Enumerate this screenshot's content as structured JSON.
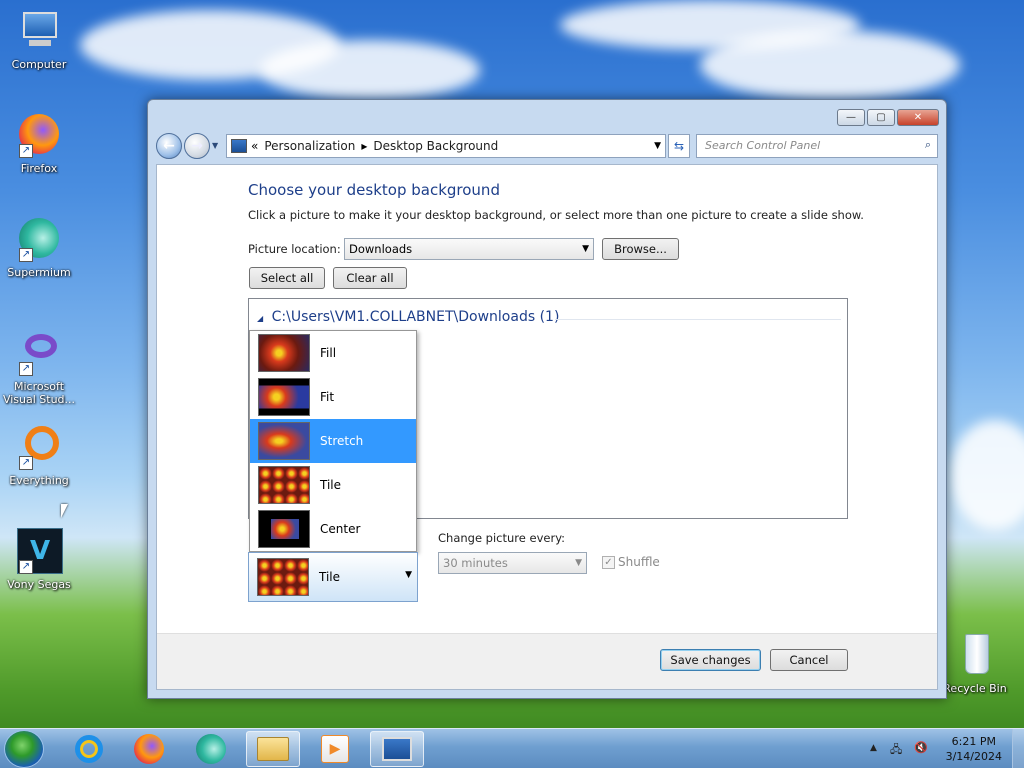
{
  "desktop": {
    "icons": [
      {
        "label": "Computer"
      },
      {
        "label": "Firefox"
      },
      {
        "label": "Supermium"
      },
      {
        "label": "Microsoft Visual Stud..."
      },
      {
        "label": "Everything"
      },
      {
        "label": "Vony Segas"
      },
      {
        "label": "Recycle Bin"
      }
    ]
  },
  "window": {
    "buttons": {
      "minimize": "—",
      "maximize": "▢",
      "close": "✕"
    },
    "address": {
      "prefix": "«",
      "crumbs": [
        "Personalization",
        "Desktop Background"
      ],
      "separator": "▸"
    },
    "search_placeholder": "Search Control Panel",
    "heading": "Choose your desktop background",
    "description": "Click a picture to make it your desktop background, or select more than one picture to create a slide show.",
    "picture_location_label": "Picture location:",
    "picture_location_value": "Downloads",
    "browse_label": "Browse...",
    "select_all_label": "Select all",
    "clear_all_label": "Clear all",
    "group_header": "C:\\Users\\VM1.COLLABNET\\Downloads (1)",
    "position_menu": [
      {
        "label": "Fill",
        "selected": false
      },
      {
        "label": "Fit",
        "selected": false
      },
      {
        "label": "Stretch",
        "selected": true
      },
      {
        "label": "Tile",
        "selected": false
      },
      {
        "label": "Center",
        "selected": false
      }
    ],
    "position_value": "Tile",
    "change_every_label": "Change picture every:",
    "change_every_value": "30 minutes",
    "shuffle_label": "Shuffle",
    "save_label": "Save changes",
    "cancel_label": "Cancel"
  },
  "taskbar": {
    "clock_time": "6:21 PM",
    "clock_date": "3/14/2024",
    "tray_arrow": "▲"
  },
  "colors": {
    "selection": "#3399ff",
    "heading": "#1e3f8a",
    "desktop_sky": "#4a8ee0"
  }
}
